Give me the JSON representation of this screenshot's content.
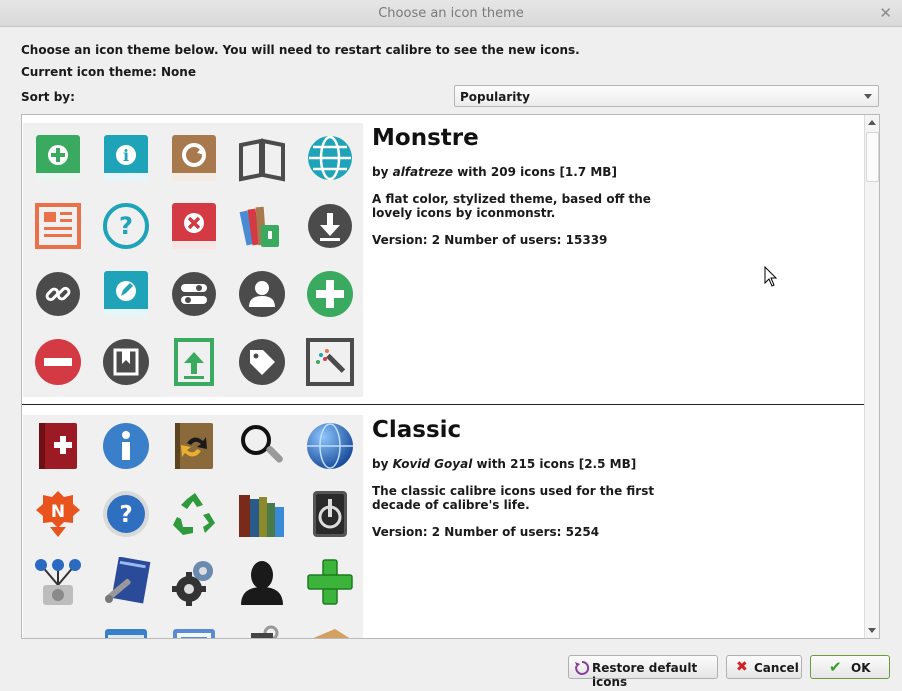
{
  "window": {
    "title": "Choose an icon theme"
  },
  "intro": "Choose an icon theme below. You will need to restart calibre to see the new icons.",
  "current": "Current icon theme: None",
  "sort": {
    "label": "Sort by:",
    "value": "Popularity"
  },
  "themes": [
    {
      "name": "Monstre",
      "by_prefix": "by ",
      "author": "alfatreze",
      "by_suffix": " with 209 icons [1.7 MB]",
      "desc": "A flat color, stylized theme, based off the lovely icons by iconmonstr.",
      "version": "Version: 2 Number of users: 15339"
    },
    {
      "name": "Classic",
      "by_prefix": "by ",
      "author": "Kovid Goyal",
      "by_suffix": " with 215 icons [2.5 MB]",
      "desc": "The classic calibre icons used for the first decade of calibre's life.",
      "version": "Version: 2 Number of users: 5254"
    }
  ],
  "buttons": {
    "restore": "Restore default icons",
    "cancel": "Cancel",
    "ok": "OK"
  },
  "colors": {
    "green": "#3aaa60",
    "teal": "#1fa3b8",
    "brown": "#a8794c",
    "red": "#d43a44",
    "dark": "#4b4b4b",
    "orange": "#e9724a"
  }
}
